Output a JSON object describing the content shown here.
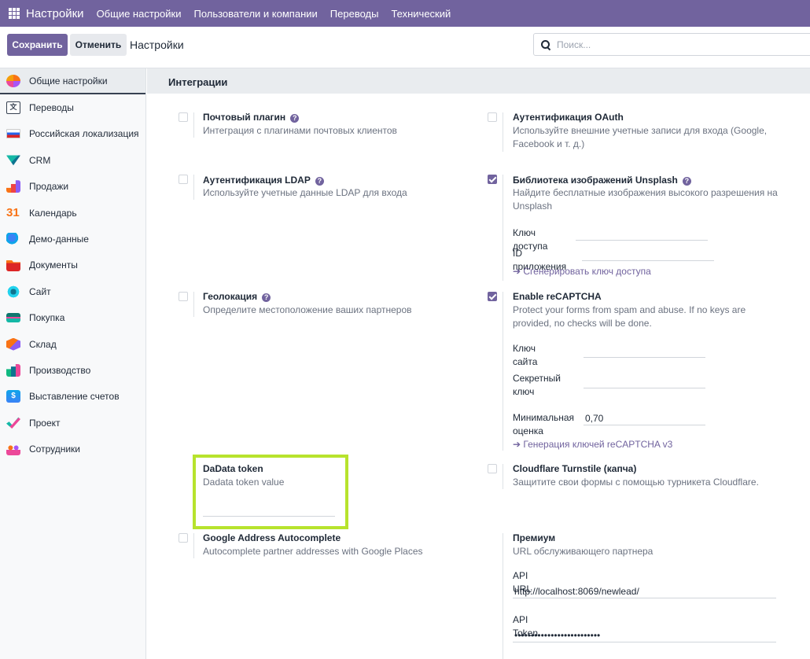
{
  "navbar": {
    "brand": "Настройки",
    "items": [
      "Общие настройки",
      "Пользователи и компании",
      "Переводы",
      "Технический"
    ]
  },
  "control": {
    "save_label": "Сохранить",
    "cancel_label": "Отменить",
    "breadcrumb": "Настройки",
    "search_placeholder": "Поиск..."
  },
  "sidebar": {
    "items": [
      {
        "label": "Общие настройки",
        "icon": "general-settings-icon"
      },
      {
        "label": "Переводы",
        "icon": "translations-icon"
      },
      {
        "label": "Российская локализация",
        "icon": "russian-flag-icon"
      },
      {
        "label": "CRM",
        "icon": "crm-icon"
      },
      {
        "label": "Продажи",
        "icon": "sales-icon"
      },
      {
        "label": "Календарь",
        "icon": "calendar-icon",
        "glyph": "31"
      },
      {
        "label": "Демо-данные",
        "icon": "demo-data-icon"
      },
      {
        "label": "Документы",
        "icon": "documents-icon"
      },
      {
        "label": "Сайт",
        "icon": "website-icon"
      },
      {
        "label": "Покупка",
        "icon": "purchase-icon"
      },
      {
        "label": "Склад",
        "icon": "inventory-icon"
      },
      {
        "label": "Производство",
        "icon": "manufacturing-icon"
      },
      {
        "label": "Выставление счетов",
        "icon": "invoicing-icon",
        "glyph": "$"
      },
      {
        "label": "Проект",
        "icon": "project-icon"
      },
      {
        "label": "Сотрудники",
        "icon": "employees-icon"
      }
    ]
  },
  "section": {
    "title": "Интеграции"
  },
  "settings": {
    "mail_plugin": {
      "title": "Почтовый плагин",
      "desc": "Интеграция с плагинами почтовых клиентов",
      "checked": false
    },
    "oauth": {
      "title": "Аутентификация OAuth",
      "desc": "Используйте внешние учетные записи для входа (Google, Facebook и т. д.)",
      "checked": false
    },
    "ldap": {
      "title": "Аутентификация LDAP",
      "desc": "Используйте учетные данные LDAP для входа",
      "checked": false
    },
    "unsplash": {
      "title": "Библиотека изображений Unsplash",
      "desc": "Найдите бесплатные изображения высокого разрешения на Unsplash",
      "checked": true,
      "access_key_label": "Ключ доступа",
      "access_key_value": "",
      "app_id_label": "ID приложения",
      "app_id_value": "",
      "link": "➔ Сгенерировать ключ доступа"
    },
    "geolocation": {
      "title": "Геолокация",
      "desc": "Определите местоположение ваших партнеров",
      "checked": false
    },
    "recaptcha": {
      "title": "Enable reCAPTCHA",
      "desc": "Protect your forms from spam and abuse. If no keys are provided, no checks will be done.",
      "checked": true,
      "site_key_label": "Ключ сайта",
      "site_key_value": "",
      "secret_key_label": "Секретный ключ",
      "secret_key_value": "",
      "min_score_label": "Минимальная оценка",
      "min_score_value": "0,70",
      "link": "➔ Генерация ключей reCAPTCHA v3"
    },
    "dadata": {
      "title": "DaData token",
      "desc": "Dadata token value",
      "value": ""
    },
    "turnstile": {
      "title": "Cloudflare Turnstile (капча)",
      "desc": "Защитите свои формы с помощью турникета Cloudflare.",
      "checked": false
    },
    "google_address": {
      "title": "Google Address Autocomplete",
      "desc": "Autocomplete partner addresses with Google Places",
      "checked": false
    },
    "premium": {
      "title": "Премиум",
      "desc": "URL обслуживающего партнера",
      "api_url_label": "API URL",
      "api_url_value": "http://localhost:8069/newlead/",
      "api_token_label": "API Token",
      "api_token_value": "••••••••••••••••••••••••••"
    }
  },
  "colors": {
    "brand": "#71639e",
    "highlight": "#b7e32d"
  }
}
